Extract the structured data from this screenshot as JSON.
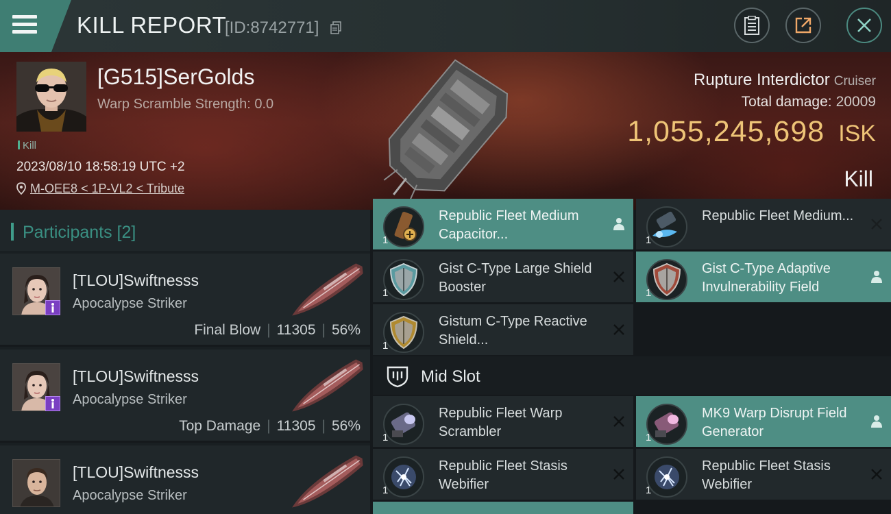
{
  "header": {
    "title": "KILL REPORT",
    "report_id": "[ID:8742771]"
  },
  "victim": {
    "name": "[G515]SerGolds",
    "scramble": "Warp Scramble Strength: 0.0",
    "tag": "Kill",
    "datetime": "2023/08/10 18:58:19 UTC +2",
    "location": "M-OEE8 < 1P-VL2 < Tribute",
    "ship_name": "Rupture Interdictor",
    "ship_class": "Cruiser",
    "damage_label": "Total damage:",
    "damage_value": "20009",
    "isk_value": "1,055,245,698",
    "isk_unit": "ISK",
    "result": "Kill"
  },
  "participants": {
    "title": "Participants [2]",
    "items": [
      {
        "name": "[TLOU]Swiftnesss",
        "ship": "Apocalypse Striker",
        "role": "Final Blow",
        "damage": "11305",
        "percent": "56%"
      },
      {
        "name": "[TLOU]Swiftnesss",
        "ship": "Apocalypse Striker",
        "role": "Top Damage",
        "damage": "11305",
        "percent": "56%"
      },
      {
        "name": "[TLOU]Swiftnesss",
        "ship": "Apocalypse Striker"
      }
    ]
  },
  "modules": {
    "low": [
      {
        "qty": "1",
        "name": "Republic Fleet Medium Capacitor...",
        "status": "dropped"
      },
      {
        "qty": "1",
        "name": "Republic Fleet Medium...",
        "status": "destroyed"
      },
      {
        "qty": "1",
        "name": "Gist C-Type Large Shield Booster",
        "status": "destroyed"
      },
      {
        "qty": "1",
        "name": "Gist C-Type Adaptive Invulnerability Field",
        "status": "dropped"
      },
      {
        "qty": "1",
        "name": "Gistum C-Type Reactive Shield...",
        "status": "destroyed"
      }
    ],
    "mid_slot_label": "Mid Slot",
    "mid": [
      {
        "qty": "1",
        "name": "Republic Fleet Warp Scrambler",
        "status": "destroyed"
      },
      {
        "qty": "1",
        "name": "MK9 Warp Disrupt Field Generator",
        "status": "dropped"
      },
      {
        "qty": "1",
        "name": "Republic Fleet Stasis Webifier",
        "status": "destroyed"
      },
      {
        "qty": "1",
        "name": "Republic Fleet Stasis Webifier",
        "status": "destroyed"
      }
    ]
  },
  "colors": {
    "accent": "#4e8e84",
    "isk": "#eec477",
    "banner": "#4a1f1a"
  }
}
